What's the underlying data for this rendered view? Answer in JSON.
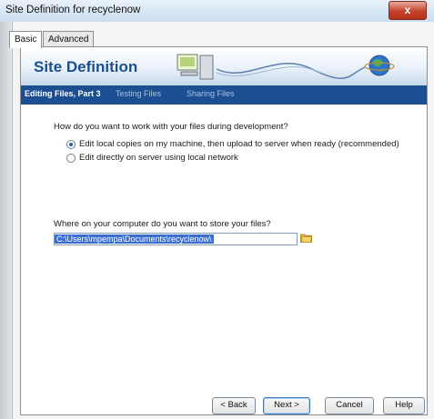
{
  "window": {
    "title": "Site Definition for recyclenow",
    "close_label": "x"
  },
  "tabs": [
    {
      "label": "Basic"
    },
    {
      "label": "Advanced"
    }
  ],
  "banner": {
    "title": "Site Definition"
  },
  "steps": [
    {
      "label": "Editing Files, Part 3"
    },
    {
      "label": "Testing Files"
    },
    {
      "label": "Sharing Files"
    }
  ],
  "question1": "How do you want to work with your files during development?",
  "options": [
    {
      "label": "Edit local copies on my machine, then upload to server when ready (recommended)",
      "checked": true
    },
    {
      "label": "Edit directly on server using local network",
      "checked": false
    }
  ],
  "question2": "Where on your computer do you want to store your files?",
  "path_value": "C:\\Users\\mpempa\\Documents\\recyclenow\\",
  "buttons": {
    "back": "< Back",
    "next": "Next >",
    "cancel": "Cancel",
    "help": "Help"
  },
  "colors": {
    "accent": "#1c4f92",
    "banner_title": "#1a4f8c",
    "close": "#c4422b"
  },
  "icons": [
    "close-icon",
    "computer-server-icon",
    "globe-icon",
    "folder-icon"
  ]
}
